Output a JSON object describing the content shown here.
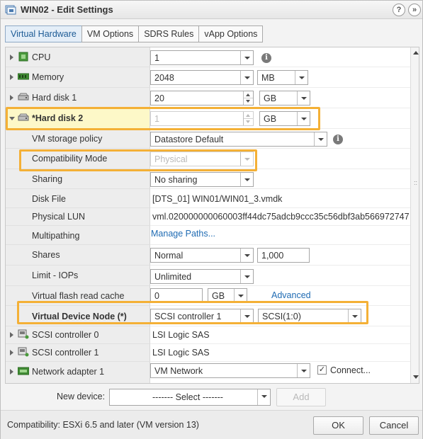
{
  "window": {
    "title": "WIN02 - Edit Settings",
    "help_label": "?",
    "expand_label": "»"
  },
  "tabs": [
    {
      "label": "Virtual Hardware",
      "active": true
    },
    {
      "label": "VM Options",
      "active": false
    },
    {
      "label": "SDRS Rules",
      "active": false
    },
    {
      "label": "vApp Options",
      "active": false
    }
  ],
  "hardware": {
    "cpu": {
      "label": "CPU",
      "value": "1",
      "info": "i"
    },
    "memory": {
      "label": "Memory",
      "value": "2048",
      "unit": "MB"
    },
    "hard_disk_1": {
      "label": "Hard disk 1",
      "value": "20",
      "unit": "GB"
    },
    "hard_disk_2": {
      "label": "*Hard disk 2",
      "value": "1",
      "unit": "GB",
      "storage_policy": {
        "label": "VM storage policy",
        "value": "Datastore Default",
        "info": "i"
      },
      "compat_mode": {
        "label": "Compatibility Mode",
        "value": "Physical"
      },
      "sharing": {
        "label": "Sharing",
        "value": "No sharing"
      },
      "disk_file": {
        "label": "Disk File",
        "value": "[DTS_01] WIN01/WIN01_3.vmdk"
      },
      "physical_lun": {
        "label": "Physical LUN",
        "value": "vml.020000000060003ff44dc75adcb9ccc35c56dbf3ab566972747"
      },
      "multipathing": {
        "label": "Multipathing",
        "value": "Manage Paths..."
      },
      "shares": {
        "label": "Shares",
        "value": "Normal",
        "amount": "1,000"
      },
      "limit_iops": {
        "label": "Limit - IOPs",
        "value": "Unlimited"
      },
      "flash_cache": {
        "label": "Virtual flash read cache",
        "value": "0",
        "unit": "GB",
        "advanced": "Advanced"
      },
      "device_node": {
        "label": "Virtual Device Node (*)",
        "controller": "SCSI controller 1",
        "slot": "SCSI(1:0)"
      }
    },
    "scsi_0": {
      "label": "SCSI controller 0",
      "value": "LSI Logic SAS"
    },
    "scsi_1": {
      "label": "SCSI controller 1",
      "value": "LSI Logic SAS"
    },
    "nic_1": {
      "label": "Network adapter 1",
      "value": "VM Network",
      "connect_label": "Connect...",
      "connected": true
    }
  },
  "new_device": {
    "label": "New device:",
    "select_value": "------- Select -------",
    "add_label": "Add"
  },
  "footer": {
    "compatibility": "Compatibility: ESXi 6.5 and later (VM version 13)",
    "ok_label": "OK",
    "cancel_label": "Cancel"
  },
  "colors": {
    "highlight": "#f4b036",
    "accent": "#1d5b95",
    "link": "#1f6bb3"
  }
}
